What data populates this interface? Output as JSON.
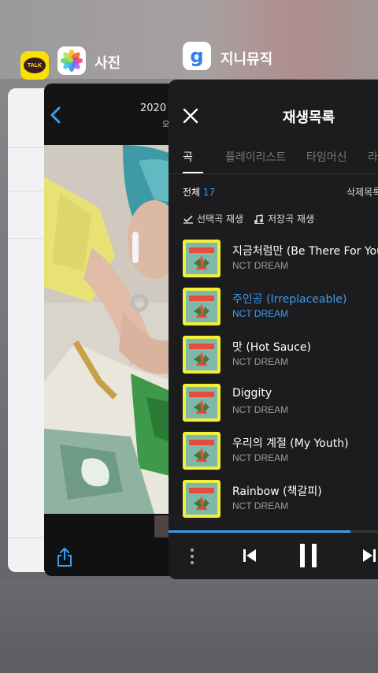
{
  "switcher": {
    "apps": [
      {
        "name": "KakaoTalk",
        "icon_text": "TALK",
        "label": ""
      },
      {
        "name": "Photos",
        "label": "사진"
      },
      {
        "name": "Genie Music",
        "icon_text": "g",
        "label": "지니뮤직"
      }
    ]
  },
  "photos": {
    "title": "2020",
    "subtitle": "오"
  },
  "genie": {
    "header_title": "재생목록",
    "tabs": [
      "곡",
      "플레이리스트",
      "타임머신",
      "라"
    ],
    "active_tab": 0,
    "count_label": "전체",
    "count_value": "17",
    "delete_label": "삭제목록",
    "actions": [
      "선택곡 재생",
      "저장곡 재생"
    ],
    "tracks": [
      {
        "title": "지금처럼만 (Be There For You)",
        "artist": "NCT DREAM",
        "playing": false
      },
      {
        "title": "주인공 (Irreplaceable)",
        "artist": "NCT DREAM",
        "playing": true
      },
      {
        "title": "맛 (Hot Sauce)",
        "artist": "NCT DREAM",
        "playing": false
      },
      {
        "title": "Diggity",
        "artist": "NCT DREAM",
        "playing": false
      },
      {
        "title": "우리의 계절 (My Youth)",
        "artist": "NCT DREAM",
        "playing": false
      },
      {
        "title": "Rainbow (책갈피)",
        "artist": "NCT DREAM",
        "playing": false
      }
    ],
    "progress": 0.87
  },
  "colors": {
    "accent": "#3b9df0",
    "card_bg": "#1c1c1e",
    "kakao_yellow": "#fae100"
  },
  "icons": [
    "close-icon",
    "back-chevron-icon",
    "share-icon",
    "more-icon",
    "previous-icon",
    "pause-icon",
    "next-icon",
    "check-icon",
    "music-note-icon"
  ]
}
